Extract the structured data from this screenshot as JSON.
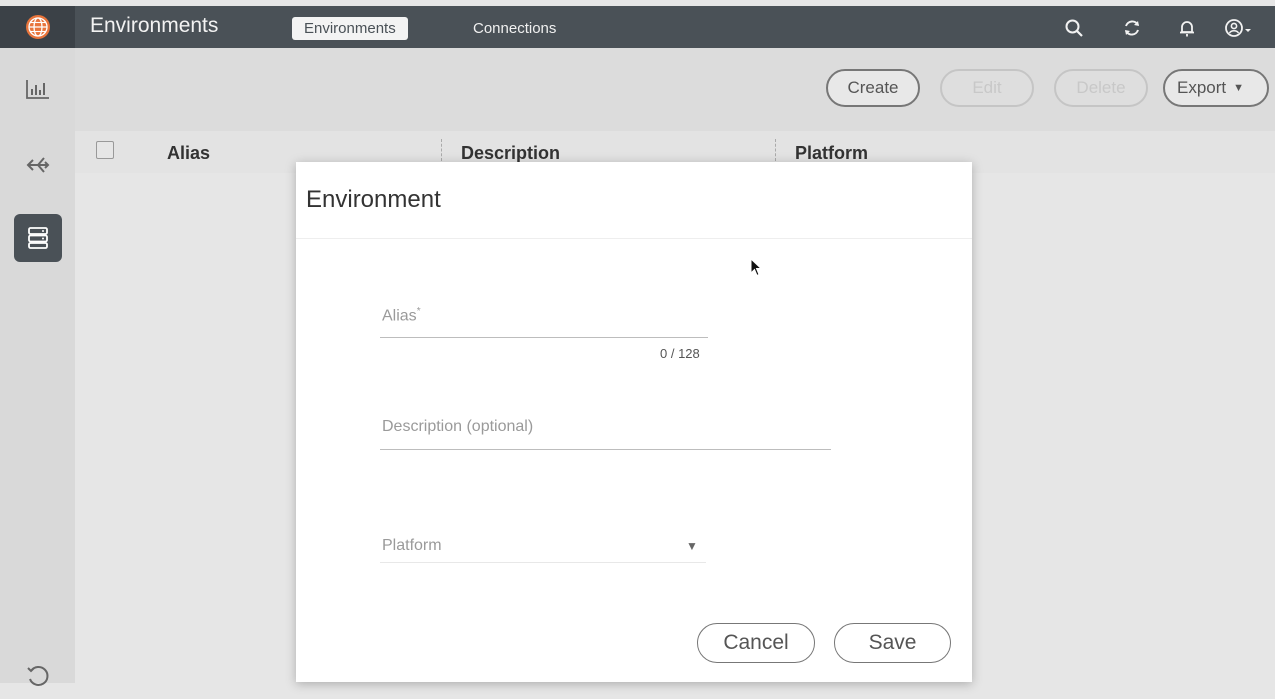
{
  "header": {
    "app_title": "Environments",
    "tabs": [
      {
        "label": "Environments",
        "active": true
      },
      {
        "label": "Connections",
        "active": false
      }
    ],
    "icons": [
      "search-icon",
      "refresh-icon",
      "bell-icon",
      "user-icon"
    ]
  },
  "rail": {
    "items": [
      "chart-icon",
      "topology-icon",
      "server-icon",
      "history-icon"
    ]
  },
  "toolbar": {
    "create_label": "Create",
    "edit_label": "Edit",
    "delete_label": "Delete",
    "export_label": "Export"
  },
  "table": {
    "columns": [
      "Alias",
      "Description",
      "Platform"
    ]
  },
  "dialog": {
    "title": "Environment",
    "alias_label": "Alias",
    "alias_counter": "0 / 128",
    "description_label": "Description (optional)",
    "platform_label": "Platform",
    "cancel_label": "Cancel",
    "save_label": "Save"
  },
  "colors": {
    "header_bg": "#4a5157",
    "rail_bg": "#d9d9d9",
    "dialog_bg": "#ffffff"
  }
}
